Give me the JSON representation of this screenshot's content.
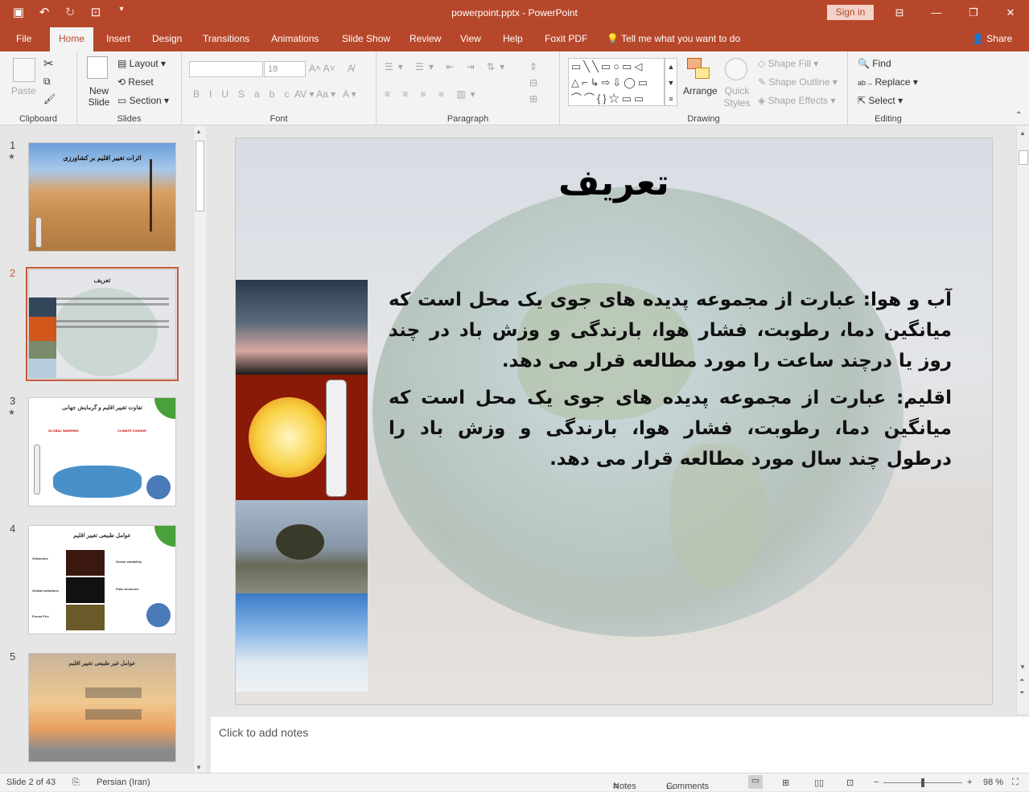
{
  "app": {
    "title": "powerpoint.pptx  -  PowerPoint",
    "sign_in": "Sign in"
  },
  "tabs": [
    "File",
    "Home",
    "Insert",
    "Design",
    "Transitions",
    "Animations",
    "Slide Show",
    "Review",
    "View",
    "Help",
    "Foxit PDF"
  ],
  "tell_me": "Tell me what you want to do",
  "share": "Share",
  "ribbon": {
    "clipboard": {
      "label": "Clipboard",
      "paste": "Paste"
    },
    "slides": {
      "label": "Slides",
      "new_slide": "New Slide",
      "layout": "Layout",
      "reset": "Reset",
      "section": "Section"
    },
    "font": {
      "label": "Font",
      "font_name": "",
      "font_size": "18"
    },
    "paragraph": {
      "label": "Paragraph"
    },
    "drawing": {
      "label": "Drawing",
      "arrange": "Arrange",
      "quick_styles": "Quick Styles",
      "shape_fill": "Shape Fill",
      "shape_outline": "Shape Outline",
      "shape_effects": "Shape Effects"
    },
    "editing": {
      "label": "Editing",
      "find": "Find",
      "replace": "Replace",
      "select": "Select"
    }
  },
  "thumbnails": [
    {
      "num": "1",
      "star": true,
      "title": "اثرات تغییر اقلیم بر کشاورزی"
    },
    {
      "num": "2",
      "star": false,
      "title": "تعریف"
    },
    {
      "num": "3",
      "star": true,
      "title": "تفاوت تغییر اقلیم و گرمایش جهانی",
      "sub1": "GLOBAL WARMING",
      "sub2": "CLIMATE CHANGE"
    },
    {
      "num": "4",
      "star": false,
      "title": "عوامل طبیعی تغییر اقلیم",
      "items": [
        "Volcanoes",
        "Ocean variability",
        "Orbital variations",
        "Plate tectonics",
        "Forest Fire"
      ]
    },
    {
      "num": "5",
      "star": false,
      "title": "عوامل غیر طبیعی تغییر اقلیم"
    }
  ],
  "slide": {
    "title": "تعریف",
    "para1": "آب و هوا: عبارت از مجموعه پدیده های جوی یک محل است که میانگین دما، رطوبت، فشار هوا، بارندگی و وزش باد در چند روز یا درچند ساعت را مورد مطالعه قرار می دهد.",
    "para2": "اقلیم: عبارت از مجموعه پدیده های جوی یک محل است که میانگین دما، رطوبت، فشار هوا، بارندگی و وزش باد را درطول چند سال مورد مطالعه قرار می دهد."
  },
  "notes_placeholder": "Click to add notes",
  "status": {
    "slide": "Slide 2 of 43",
    "language": "Persian (Iran)",
    "notes": "Notes",
    "comments": "Comments",
    "zoom": "98 %"
  }
}
